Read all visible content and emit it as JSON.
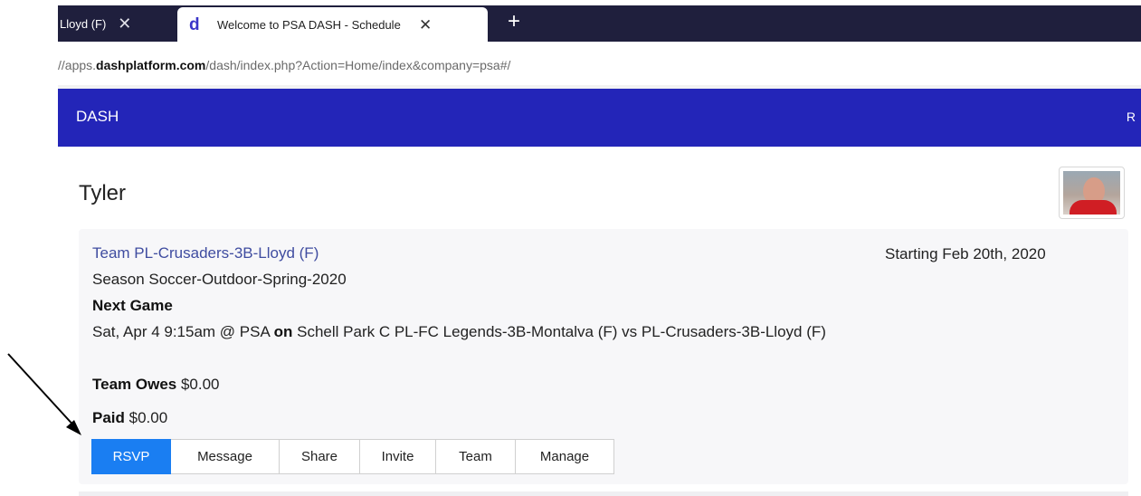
{
  "browser": {
    "tabs": [
      {
        "title": "Lloyd (F)"
      },
      {
        "title": "Welcome to PSA DASH - Schedule",
        "favicon": "d"
      }
    ],
    "new_tab_symbol": "+",
    "close_symbol": "✕",
    "address": {
      "prefix": "//apps.",
      "host": "dashplatform.com",
      "path": "/dash/index.php?Action=Home/index&company=psa#/"
    }
  },
  "navbar": {
    "brand": "DASH",
    "right_text": "R",
    "color": "#2325b8"
  },
  "page": {
    "title": "Tyler"
  },
  "card": {
    "team_link": "Team PL-Crusaders-3B-Lloyd (F)",
    "starting": "Starting Feb 20th, 2020",
    "season": "Season Soccer-Outdoor-Spring-2020",
    "next_game_heading": "Next Game",
    "next_game": {
      "when": "Sat, Apr 4 9:15am @ PSA",
      "on": "on",
      "details": "Schell Park C PL-FC Legends-3B-Montalva (F) vs PL-Crusaders-3B-Lloyd (F)"
    },
    "team_owes_label": "Team Owes",
    "team_owes_value": "$0.00",
    "paid_label": "Paid",
    "paid_value": "$0.00",
    "buttons": [
      {
        "label": "RSVP",
        "primary": true
      },
      {
        "label": "Message"
      },
      {
        "label": "Share"
      },
      {
        "label": "Invite"
      },
      {
        "label": "Team"
      },
      {
        "label": "Manage"
      }
    ]
  },
  "colors": {
    "accent_button": "#1a7ef2",
    "link": "#3f4ca0"
  }
}
